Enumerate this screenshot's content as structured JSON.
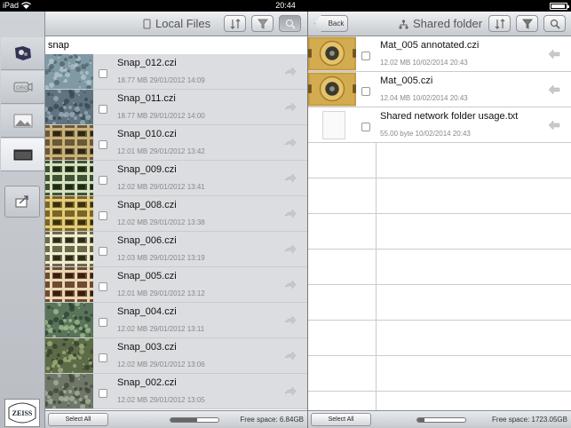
{
  "status": {
    "device": "iPad",
    "time": "20:44",
    "battery_level": 0.85
  },
  "left_pane": {
    "title": "Local Files",
    "search_value": "snap",
    "select_all_label": "Select All",
    "free_space": "Free space: 6.84GB",
    "space_used": 0.55,
    "files": [
      {
        "name": "Snap_012.czi",
        "meta": "18.77 MB 29/01/2012 14:09",
        "thumb": "granular"
      },
      {
        "name": "Snap_011.czi",
        "meta": "18.77 MB 29/01/2012 14:00",
        "thumb": "granular-dark"
      },
      {
        "name": "Snap_010.czi",
        "meta": "12.01 MB 29/01/2012 13:42",
        "thumb": "grid-brown"
      },
      {
        "name": "Snap_009.czi",
        "meta": "12.02 MB 29/01/2012 13:41",
        "thumb": "grid-green"
      },
      {
        "name": "Snap_008.czi",
        "meta": "12.02 MB 29/01/2012 13:38",
        "thumb": "grid-gold"
      },
      {
        "name": "Snap_006.czi",
        "meta": "12.03 MB 29/01/2012 13:19",
        "thumb": "grid-white"
      },
      {
        "name": "Snap_005.czi",
        "meta": "12.01 MB 29/01/2012 13:12",
        "thumb": "grid-red"
      },
      {
        "name": "Snap_004.czi",
        "meta": "12.02 MB 29/01/2012 13:11",
        "thumb": "texture-green"
      },
      {
        "name": "Snap_003.czi",
        "meta": "12.02 MB 29/01/2012 13:06",
        "thumb": "texture-moss"
      },
      {
        "name": "Snap_002.czi",
        "meta": "12.02 MB 29/01/2012 13:05",
        "thumb": "texture-stone"
      }
    ]
  },
  "right_pane": {
    "back_label": "Back",
    "title": "Shared folder",
    "select_all_label": "Select All",
    "free_space": "Free space: 1723.05GB",
    "space_used": 0.15,
    "files": [
      {
        "name": "Mat_005 annotated.czi",
        "meta": "12.02 MB 10/02/2014 20:43",
        "thumb": "pad"
      },
      {
        "name": "Mat_005.czi",
        "meta": "12.04 MB 10/02/2014 20:43",
        "thumb": "pad"
      },
      {
        "name": "Shared network folder usage.txt",
        "meta": "55.00 byte 10/02/2014 20:43",
        "thumb": "document"
      }
    ],
    "empty_rows": 8
  },
  "toolstrip": {
    "items": [
      {
        "icon": "gallery-icon",
        "active": false
      },
      {
        "icon": "camera-icon",
        "active": false
      },
      {
        "icon": "image-icon",
        "active": false
      },
      {
        "icon": "folder-icon",
        "active": true
      },
      {
        "icon": "export-icon",
        "active": false
      }
    ],
    "logo": "ZEISS"
  },
  "colors": {
    "nav_gradient_top": "#eef0f2",
    "row_bg": "#dcdde0",
    "meta_text": "#888888"
  }
}
